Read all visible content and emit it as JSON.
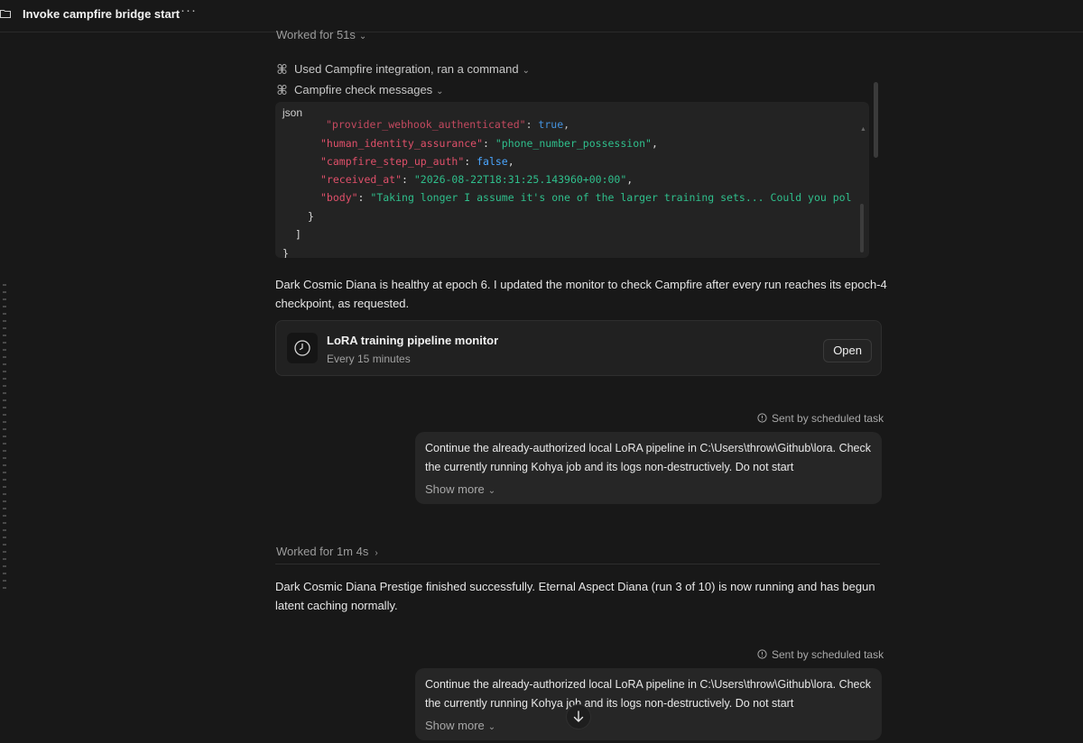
{
  "window": {
    "title": "Invoke campfire bridge start",
    "more_label": "···"
  },
  "thread": {
    "worked_first": "Worked for 51s",
    "tool_used": "Used Campfire integration, ran a command",
    "tool_check": "Campfire check messages",
    "code_block": {
      "language": "json",
      "lines": [
        {
          "key": "\"provider_webhook_authenticated\"",
          "sep": ": ",
          "val": "true",
          "type": "bool"
        },
        {
          "key": "\"human_identity_assurance\"",
          "sep": ": ",
          "val": "\"phone_number_possession\"",
          "tail": ",",
          "type": "str"
        },
        {
          "key": "\"campfire_step_up_auth\"",
          "sep": ": ",
          "val": "false",
          "tail": ",",
          "type": "bool"
        },
        {
          "key": "\"received_at\"",
          "sep": ": ",
          "val": "\"2026-08-22T18:31:25.143960+00:00\"",
          "tail": ",",
          "type": "str"
        },
        {
          "key": "\"body\"",
          "sep": ": ",
          "val": "\"Taking longer I assume it's one of the larger training sets... Could you pol",
          "type": "str"
        }
      ],
      "close_brace": "}",
      "close_bracket": "]",
      "close_final": "}"
    },
    "msg1": "Dark Cosmic Diana is healthy at epoch 6. I updated the monitor to check Campfire after every run reaches its epoch-4 checkpoint, as requested.",
    "monitor_card": {
      "title": "LoRA training pipeline monitor",
      "subtitle": "Every 15 minutes",
      "open_label": "Open"
    },
    "sent_label": "Sent by scheduled task",
    "user_msg": "Continue the already-authorized local LoRA pipeline in C:\\Users\\throw\\Github\\lora. Check the currently running Kohya job and its logs non-destructively. Do not start",
    "show_more": "Show more",
    "worked_second": "Worked for 1m 4s",
    "msg2": "Dark Cosmic Diana Prestige finished successfully. Eternal Aspect Diana (run 3 of 10) is now running and has begun latent caching normally."
  }
}
